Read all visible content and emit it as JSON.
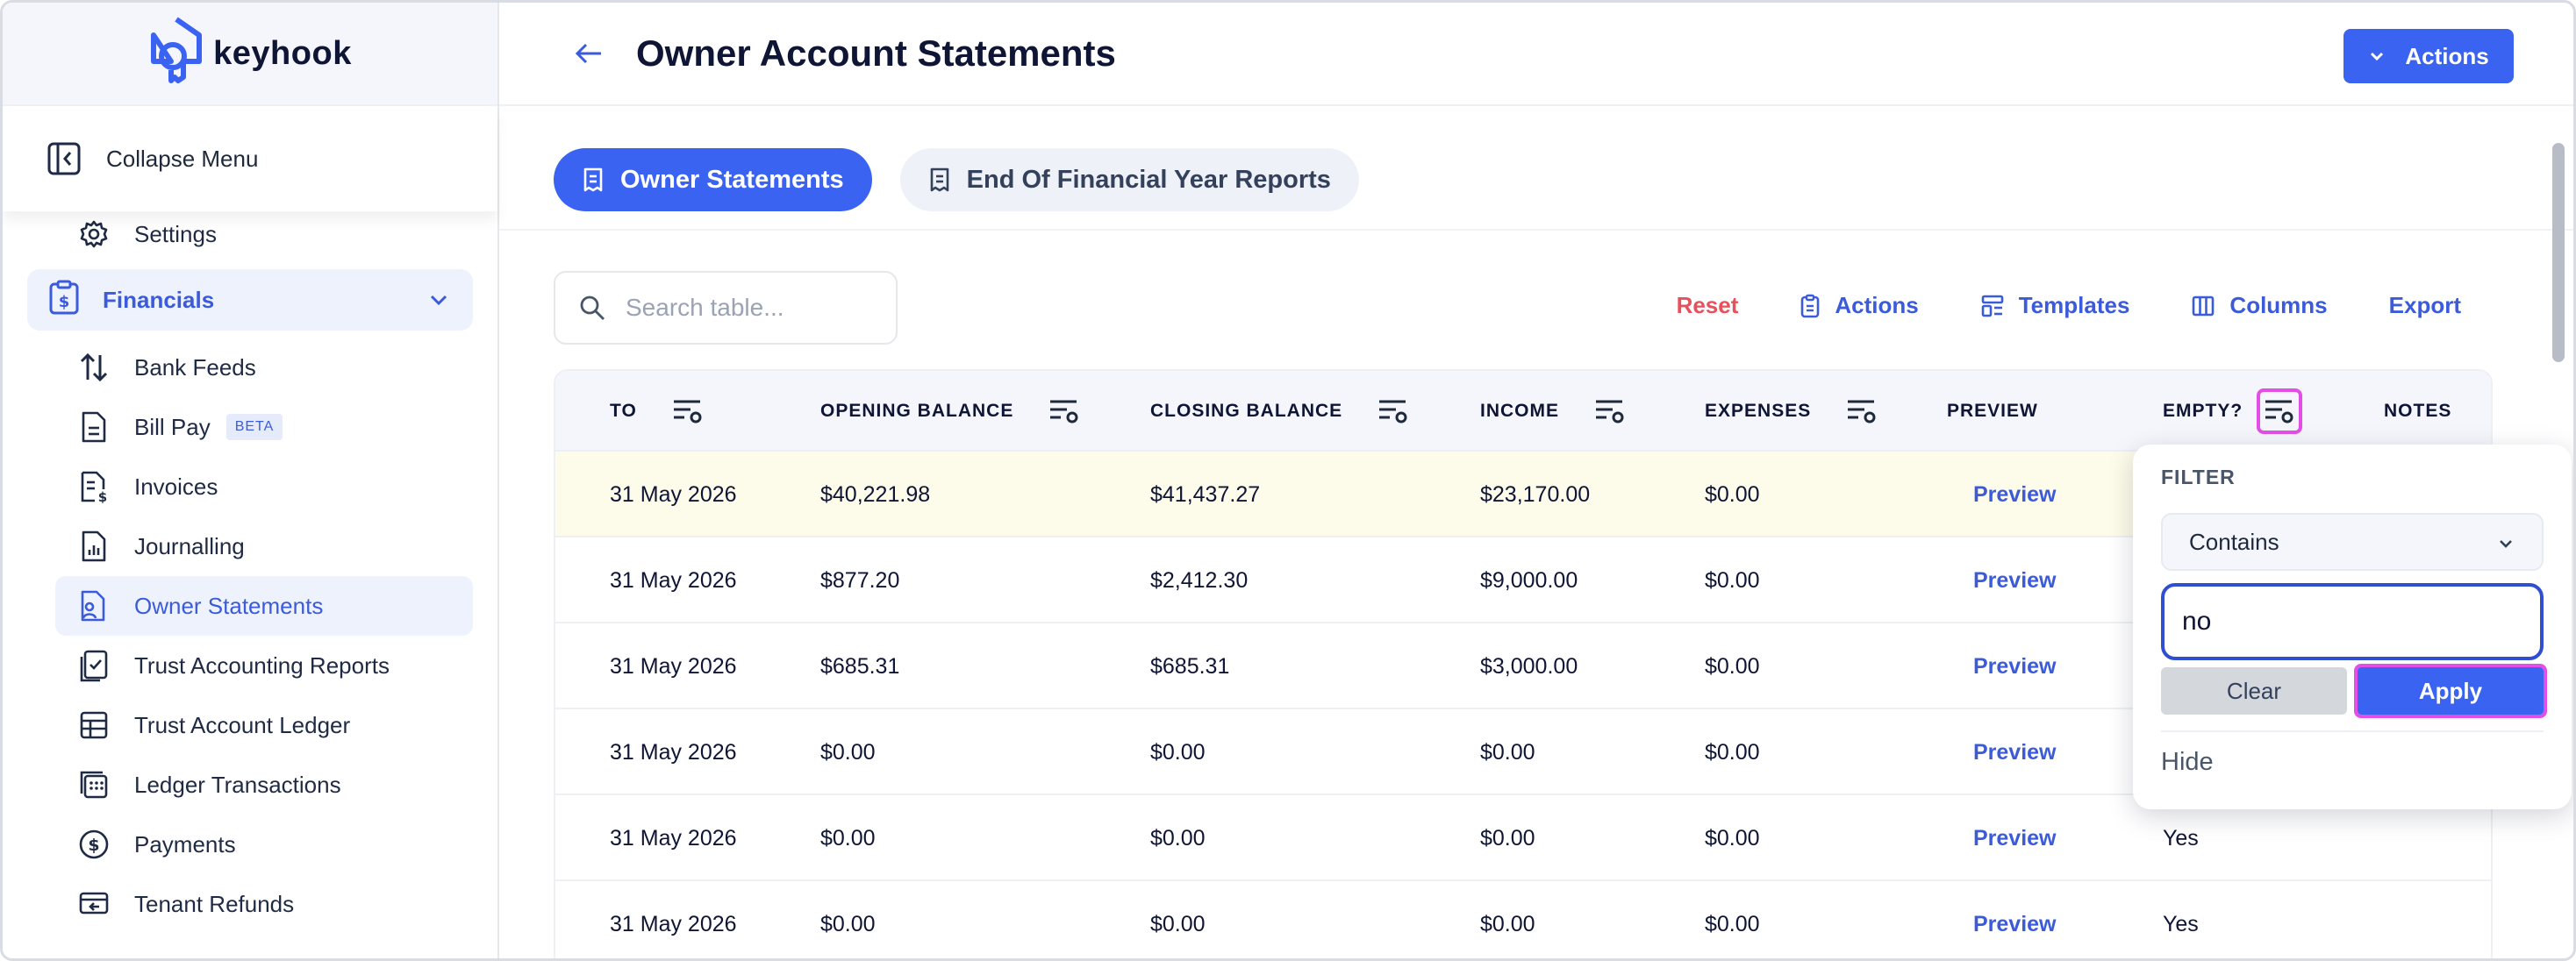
{
  "app": {
    "brand": "keyhook"
  },
  "sidebar": {
    "collapse_label": "Collapse Menu",
    "settings_label": "Settings",
    "financials_label": "Financials",
    "items": [
      {
        "label": "Bank Feeds",
        "icon": "arrows-up-down-icon"
      },
      {
        "label": "Bill Pay",
        "icon": "document-icon",
        "badge": "BETA"
      },
      {
        "label": "Invoices",
        "icon": "invoice-icon"
      },
      {
        "label": "Journalling",
        "icon": "chart-document-icon"
      },
      {
        "label": "Owner Statements",
        "icon": "owner-statement-icon",
        "active": true
      },
      {
        "label": "Trust Accounting Reports",
        "icon": "clipboard-check-icon"
      },
      {
        "label": "Trust Account Ledger",
        "icon": "table-icon"
      },
      {
        "label": "Ledger Transactions",
        "icon": "calculator-icon"
      },
      {
        "label": "Payments",
        "icon": "dollar-circle-icon"
      },
      {
        "label": "Tenant Refunds",
        "icon": "refund-icon"
      }
    ]
  },
  "header": {
    "title": "Owner Account Statements",
    "actions_label": "Actions"
  },
  "tabs": [
    {
      "label": "Owner Statements",
      "active": true
    },
    {
      "label": "End Of Financial Year Reports",
      "active": false
    }
  ],
  "toolbar": {
    "search_placeholder": "Search table...",
    "reset": "Reset",
    "actions": "Actions",
    "templates": "Templates",
    "columns": "Columns",
    "export": "Export"
  },
  "table": {
    "columns": [
      "TO",
      "OPENING BALANCE",
      "CLOSING BALANCE",
      "INCOME",
      "EXPENSES",
      "PREVIEW",
      "EMPTY?",
      "NOTES"
    ],
    "rows": [
      {
        "to": "31 May 2026",
        "opening": "$40,221.98",
        "closing": "$41,437.27",
        "income": "$23,170.00",
        "expenses": "$0.00",
        "preview": "Preview",
        "empty": ""
      },
      {
        "to": "31 May 2026",
        "opening": "$877.20",
        "closing": "$2,412.30",
        "income": "$9,000.00",
        "expenses": "$0.00",
        "preview": "Preview",
        "empty": ""
      },
      {
        "to": "31 May 2026",
        "opening": "$685.31",
        "closing": "$685.31",
        "income": "$3,000.00",
        "expenses": "$0.00",
        "preview": "Preview",
        "empty": ""
      },
      {
        "to": "31 May 2026",
        "opening": "$0.00",
        "closing": "$0.00",
        "income": "$0.00",
        "expenses": "$0.00",
        "preview": "Preview",
        "empty": ""
      },
      {
        "to": "31 May 2026",
        "opening": "$0.00",
        "closing": "$0.00",
        "income": "$0.00",
        "expenses": "$0.00",
        "preview": "Preview",
        "empty": "Yes"
      },
      {
        "to": "31 May 2026",
        "opening": "$0.00",
        "closing": "$0.00",
        "income": "$0.00",
        "expenses": "$0.00",
        "preview": "Preview",
        "empty": "Yes"
      }
    ]
  },
  "filter": {
    "label": "FILTER",
    "operator": "Contains",
    "value": "no",
    "clear": "Clear",
    "apply": "Apply",
    "hide": "Hide"
  },
  "colors": {
    "accent": "#3b63f2",
    "reset": "#e8505b",
    "highlight": "#e24ee6",
    "row_highlight": "#fdfbe9"
  }
}
